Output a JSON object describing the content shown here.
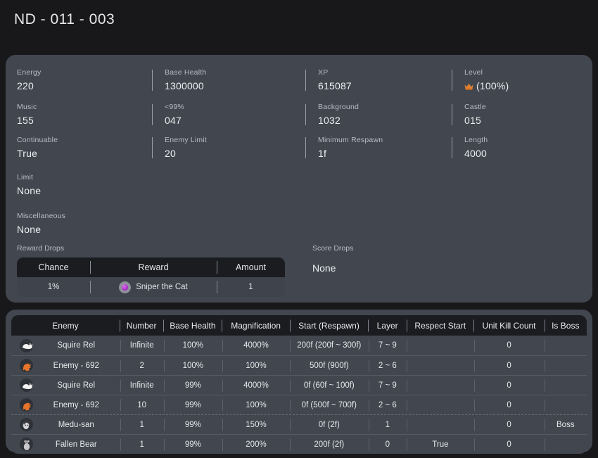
{
  "header": {
    "title": "ND - 011 - 003"
  },
  "stats": {
    "rows": [
      [
        {
          "label": "Energy",
          "value": "220"
        },
        {
          "label": "Base Health",
          "value": "1300000"
        },
        {
          "label": "XP",
          "value": "615087"
        },
        {
          "label": "Level",
          "value": "(100%)",
          "icon": "crown-icon"
        }
      ],
      [
        {
          "label": "Music",
          "value": "155"
        },
        {
          "label": "<99%",
          "value": "047"
        },
        {
          "label": "Background",
          "value": "1032"
        },
        {
          "label": "Castle",
          "value": "015"
        }
      ],
      [
        {
          "label": "Continuable",
          "value": "True"
        },
        {
          "label": "Enemy Limit",
          "value": "20"
        },
        {
          "label": "Minimum Respawn",
          "value": "1f"
        },
        {
          "label": "Length",
          "value": "4000"
        }
      ]
    ],
    "wide": [
      {
        "label": "Limit",
        "value": "None"
      },
      {
        "label": "Miscellaneous",
        "value": "None"
      }
    ]
  },
  "reward_drops": {
    "label": "Reward Drops",
    "columns": [
      "Chance",
      "Reward",
      "Amount"
    ],
    "rows": [
      {
        "chance": "1%",
        "reward": "Sniper the Cat",
        "amount": "1",
        "icon": "reward-orb-icon"
      }
    ]
  },
  "score_drops": {
    "label": "Score Drops",
    "value": "None"
  },
  "enemy_table": {
    "columns": [
      "Enemy",
      "Number",
      "Base Health",
      "Magnification",
      "Start (Respawn)",
      "Layer",
      "Respect Start",
      "Unit Kill Count",
      "Is Boss"
    ],
    "rows": [
      {
        "icon": "squire-rel-icon",
        "enemy": "Squire Rel",
        "number": "Infinite",
        "base_health": "100%",
        "magnification": "4000%",
        "start": "200f (200f ~ 300f)",
        "layer": "7 ~ 9",
        "respect_start": "",
        "unit_kill_count": "0",
        "is_boss": "",
        "separator": "solid"
      },
      {
        "icon": "enemy-692-icon",
        "enemy": "Enemy - 692",
        "number": "2",
        "base_health": "100%",
        "magnification": "100%",
        "start": "500f (900f)",
        "layer": "2 ~ 6",
        "respect_start": "",
        "unit_kill_count": "0",
        "is_boss": "",
        "separator": "solid"
      },
      {
        "icon": "squire-rel-icon",
        "enemy": "Squire Rel",
        "number": "Infinite",
        "base_health": "99%",
        "magnification": "4000%",
        "start": "0f (60f ~ 100f)",
        "layer": "7 ~ 9",
        "respect_start": "",
        "unit_kill_count": "0",
        "is_boss": "",
        "separator": "solid"
      },
      {
        "icon": "enemy-692-icon",
        "enemy": "Enemy - 692",
        "number": "10",
        "base_health": "99%",
        "magnification": "100%",
        "start": "0f (500f ~ 700f)",
        "layer": "2 ~ 6",
        "respect_start": "",
        "unit_kill_count": "0",
        "is_boss": "",
        "separator": "solid"
      },
      {
        "icon": "medu-san-icon",
        "enemy": "Medu-san",
        "number": "1",
        "base_health": "99%",
        "magnification": "150%",
        "start": "0f (2f)",
        "layer": "1",
        "respect_start": "",
        "unit_kill_count": "0",
        "is_boss": "Boss",
        "separator": "dashed"
      },
      {
        "icon": "fallen-bear-icon",
        "enemy": "Fallen Bear",
        "number": "1",
        "base_health": "99%",
        "magnification": "200%",
        "start": "200f (2f)",
        "layer": "0",
        "respect_start": "True",
        "unit_kill_count": "0",
        "is_boss": "",
        "separator": "solid"
      }
    ]
  },
  "colors": {
    "page_background": "#18181b",
    "card_background": "#41464f",
    "table_header_background": "#1b1c20",
    "accent_crown": "#e08030",
    "accent_reward_orb": "#b12fd1",
    "text_primary": "#edeef0",
    "text_muted": "#b7bcc6"
  }
}
